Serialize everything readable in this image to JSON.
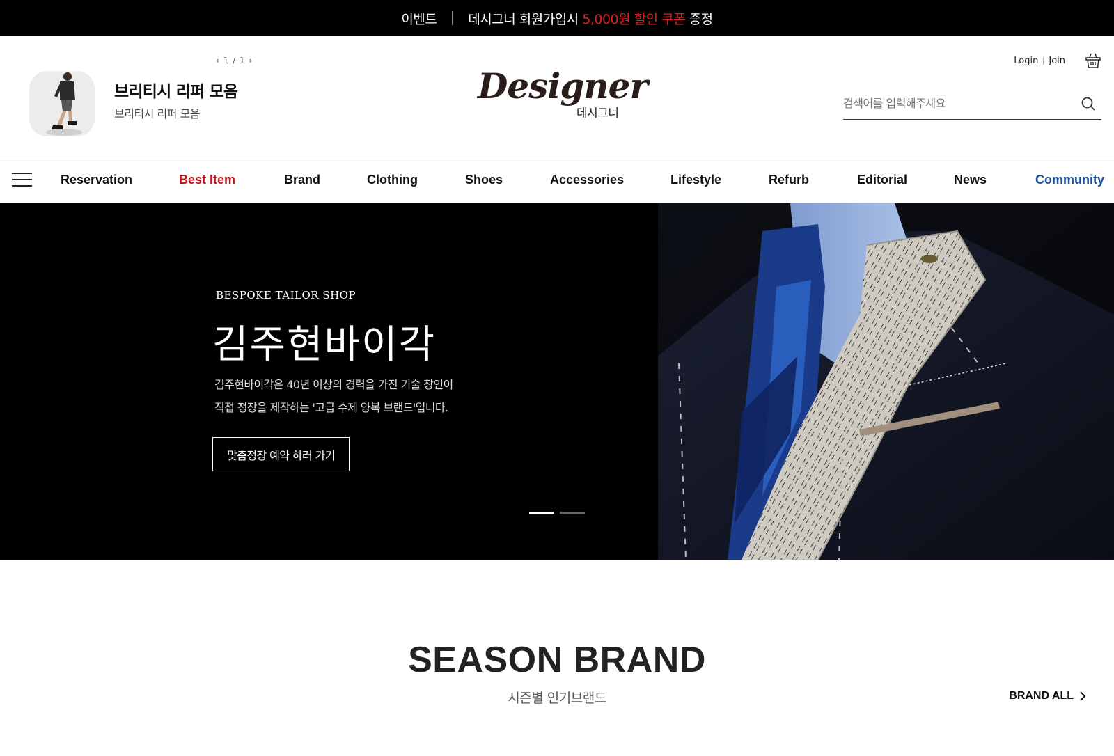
{
  "event_bar": {
    "label": "이벤트",
    "text_pre": "데시그너 회원가입시",
    "text_highlight": "5,000원 할인 쿠폰",
    "text_post": "증정",
    "highlight_color": "#d92323"
  },
  "header": {
    "promo": {
      "pager": "‹ 1 / 1 ›",
      "title": "브리티시 리퍼 모음",
      "subtitle": "브리티시 리퍼 모음"
    },
    "logo": {
      "script": "Designer",
      "korean": "데시그너"
    },
    "account": {
      "login": "Login",
      "join": "Join"
    },
    "search": {
      "placeholder": "검색어를 입력해주세요"
    }
  },
  "nav": {
    "items": [
      {
        "label": "Reservation",
        "color": "#111111"
      },
      {
        "label": "Best Item",
        "color": "#c4161c"
      },
      {
        "label": "Brand",
        "color": "#111111"
      },
      {
        "label": "Clothing",
        "color": "#111111"
      },
      {
        "label": "Shoes",
        "color": "#111111"
      },
      {
        "label": "Accessories",
        "color": "#111111"
      },
      {
        "label": "Lifestyle",
        "color": "#111111"
      },
      {
        "label": "Refurb",
        "color": "#111111"
      },
      {
        "label": "Editorial",
        "color": "#111111"
      },
      {
        "label": "News",
        "color": "#111111"
      },
      {
        "label": "Community",
        "color": "#1a4f9c"
      }
    ]
  },
  "hero": {
    "eyebrow": "BESPOKE TAILOR SHOP",
    "title": "김주현바이각",
    "desc_line1": "김주현바이각은 40년 이상의 경력을 가진 기술 장인이",
    "desc_line2": "직접 정장을 제작하는 '고급 수제 양복 브랜드'입니다.",
    "button": "맞춤정장 예약 하러 가기",
    "slides_total": 2,
    "active_slide": 1
  },
  "season": {
    "title": "SEASON BRAND",
    "subtitle": "시즌별 인기브랜드",
    "link": "BRAND ALL"
  }
}
